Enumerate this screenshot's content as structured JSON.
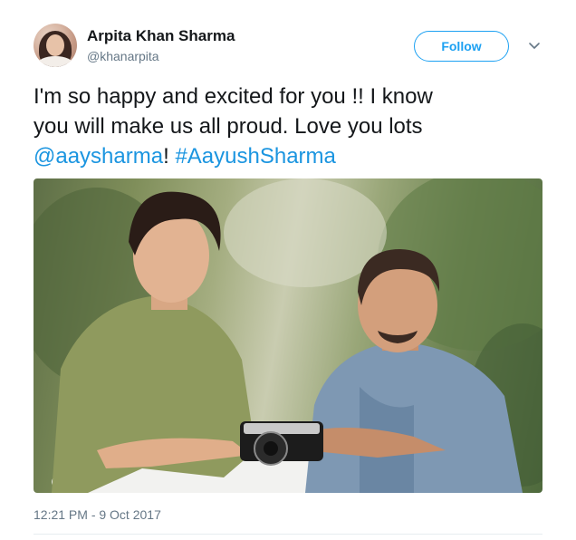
{
  "user": {
    "name": "Arpita Khan Sharma",
    "handle": "@khanarpita"
  },
  "actions": {
    "follow_label": "Follow"
  },
  "tweet": {
    "line1": "I'm so happy and excited for you !! I know",
    "line2": "you will make us all proud. Love you lots",
    "mention": "@aaysharma",
    "exclaim": "! ",
    "hashtag": "#AayushSharma",
    "timestamp": "12:21 PM - 9 Oct 2017"
  },
  "icons": {
    "caret": "chevron-down-icon"
  },
  "colors": {
    "link": "#1b95e0",
    "follow": "#1da1f2",
    "muted": "#657786"
  }
}
